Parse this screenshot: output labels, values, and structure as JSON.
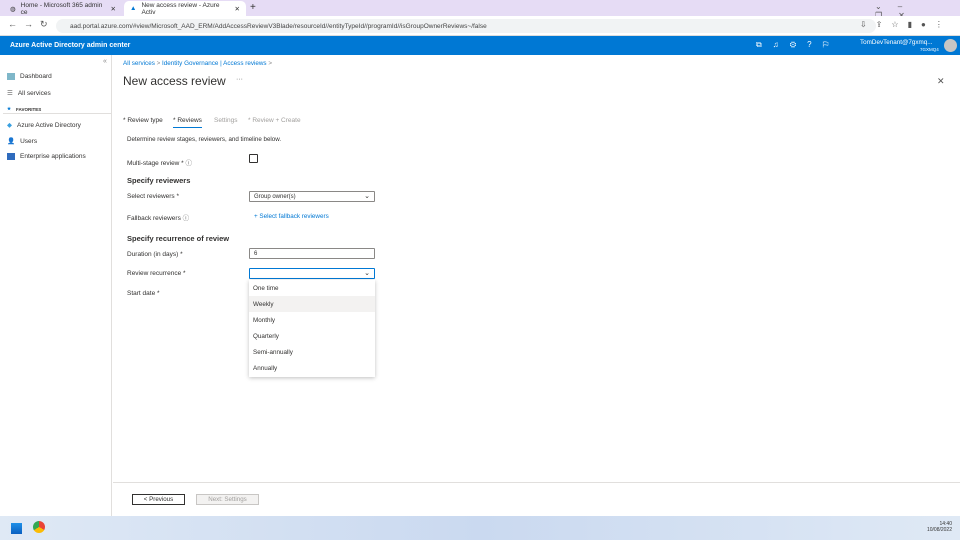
{
  "browser": {
    "tabs": [
      {
        "title": "Home - Microsoft 365 admin ce"
      },
      {
        "title": "New access review - Azure Activ"
      }
    ],
    "url": "aad.portal.azure.com/#view/Microsoft_AAD_ERM/AddAccessReviewV3Blade/resourceId//entityTypeId//programId//isGroupOwnerReviews~/false"
  },
  "header": {
    "title": "Azure Active Directory admin center",
    "user": "TomDevTenant@7gxmq...",
    "tenant": "7GXMQ4"
  },
  "sidebar": {
    "items": [
      {
        "label": "Dashboard"
      },
      {
        "label": "All services"
      }
    ],
    "favorites_label": "FAVORITES",
    "favorites": [
      {
        "label": "Azure Active Directory"
      },
      {
        "label": "Users"
      },
      {
        "label": "Enterprise applications"
      }
    ]
  },
  "breadcrumb": [
    "All services",
    "Identity Governance | Access reviews"
  ],
  "page": {
    "title": "New access review",
    "more": "···",
    "close": "✕"
  },
  "wizard_tabs": [
    "* Review type",
    "* Reviews",
    "Settings",
    "* Review + Create"
  ],
  "form": {
    "intro": "Determine review stages, reviewers, and timeline below.",
    "multistage_label": "Multi-stage review *",
    "reviewers_heading": "Specify reviewers",
    "select_reviewers_label": "Select reviewers *",
    "select_reviewers_value": "Group owner(s)",
    "fallback_label": "Fallback reviewers",
    "fallback_link": "+ Select fallback reviewers",
    "recurrence_heading": "Specify recurrence of review",
    "duration_label": "Duration (in days) *",
    "duration_value": "6",
    "recurrence_label": "Review recurrence *",
    "recurrence_value": "",
    "start_label": "Start date *",
    "recurrence_options": [
      "One time",
      "Weekly",
      "Monthly",
      "Quarterly",
      "Semi-annually",
      "Annually"
    ]
  },
  "footer": {
    "previous": "< Previous",
    "next": "Next: Settings"
  },
  "taskbar": {
    "time": "14:40",
    "date": "10/08/2022"
  }
}
